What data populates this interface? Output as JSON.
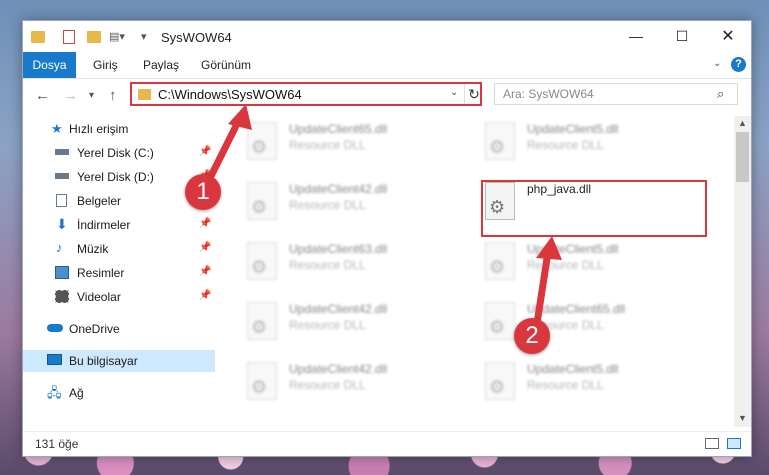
{
  "window": {
    "title": "SysWOW64"
  },
  "controls": {
    "minimize": "—",
    "maximize": "☐",
    "close": "✕"
  },
  "ribbon": {
    "file": "Dosya",
    "home": "Giriş",
    "share": "Paylaş",
    "view": "Görünüm",
    "help": "?"
  },
  "address": {
    "path": "C:\\Windows\\SysWOW64",
    "refresh": "↻"
  },
  "search": {
    "placeholder": "Ara: SysWOW64"
  },
  "sidebar": {
    "items": [
      {
        "label": "Hızlı erişim",
        "icon": "star-icon",
        "pinned": false
      },
      {
        "label": "Yerel Disk (C:)",
        "icon": "drive-icon",
        "pinned": true
      },
      {
        "label": "Yerel Disk (D:)",
        "icon": "drive-icon",
        "pinned": true
      },
      {
        "label": "Belgeler",
        "icon": "documents-icon",
        "pinned": true
      },
      {
        "label": "İndirmeler",
        "icon": "download-icon",
        "pinned": true
      },
      {
        "label": "Müzik",
        "icon": "music-icon",
        "pinned": true
      },
      {
        "label": "Resimler",
        "icon": "pictures-icon",
        "pinned": true
      },
      {
        "label": "Videolar",
        "icon": "videos-icon",
        "pinned": true
      },
      {
        "label": "OneDrive",
        "icon": "cloud-icon",
        "pinned": false
      },
      {
        "label": "Bu bilgisayar",
        "icon": "computer-icon",
        "pinned": false,
        "selected": true
      },
      {
        "label": "Ağ",
        "icon": "network-icon",
        "pinned": false
      }
    ]
  },
  "files": [
    {
      "name": "UpdateClient65.dll",
      "type": "Resource DLL"
    },
    {
      "name": "UpdateClient5.dll",
      "type": "Resource DLL"
    },
    {
      "name": "UpdateClient42.dll",
      "type": "Resource DLL"
    },
    {
      "name": "php_java.dll",
      "type": "",
      "highlighted": true
    },
    {
      "name": "UpdateClient63.dll",
      "type": "Resource DLL"
    },
    {
      "name": "UpdateClient5.dll",
      "type": "Resource DLL"
    },
    {
      "name": "UpdateClient42.dll",
      "type": "Resource DLL"
    },
    {
      "name": "UpdateClient65.dll",
      "type": "Resource DLL"
    },
    {
      "name": "UpdateClient42.dll",
      "type": "Resource DLL"
    },
    {
      "name": "UpdateClient5.dll",
      "type": "Resource DLL"
    }
  ],
  "status": {
    "count": "131 öğe"
  },
  "annotations": {
    "step1": "1",
    "step2": "2",
    "color": "#d9363e"
  }
}
